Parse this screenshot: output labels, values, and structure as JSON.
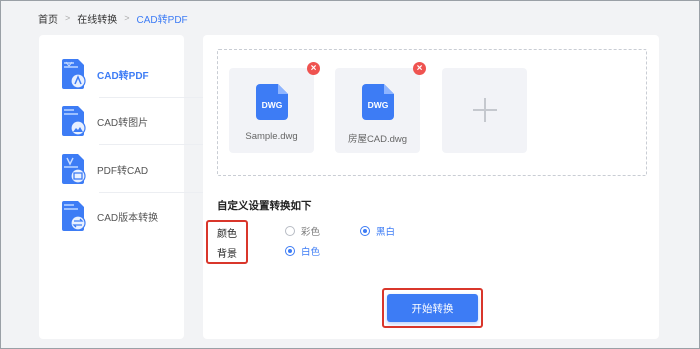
{
  "breadcrumb": {
    "home": "首页",
    "convert": "在线转换",
    "current": "CAD转PDF"
  },
  "sidebar": {
    "items": [
      {
        "label": "CAD转PDF",
        "icon": "cad-to-pdf-icon",
        "active": true
      },
      {
        "label": "CAD转图片",
        "icon": "cad-to-image-icon",
        "active": false
      },
      {
        "label": "PDF转CAD",
        "icon": "pdf-to-cad-icon",
        "active": false
      },
      {
        "label": "CAD版本转换",
        "icon": "cad-version-icon",
        "active": false
      }
    ]
  },
  "files": [
    {
      "name": "Sample.dwg",
      "type": "DWG"
    },
    {
      "name": "房屋CAD.dwg",
      "type": "DWG"
    }
  ],
  "settings": {
    "title": "自定义设置转换如下",
    "color_label": "颜色",
    "color_options": [
      {
        "label": "彩色",
        "checked": false
      },
      {
        "label": "黑白",
        "checked": true
      }
    ],
    "background_label": "背景",
    "background_options": [
      {
        "label": "白色",
        "checked": true
      }
    ]
  },
  "start_button": "开始转换",
  "colors": {
    "accent": "#3d7cf5",
    "highlight": "#d9362b",
    "remove": "#ef5350"
  }
}
